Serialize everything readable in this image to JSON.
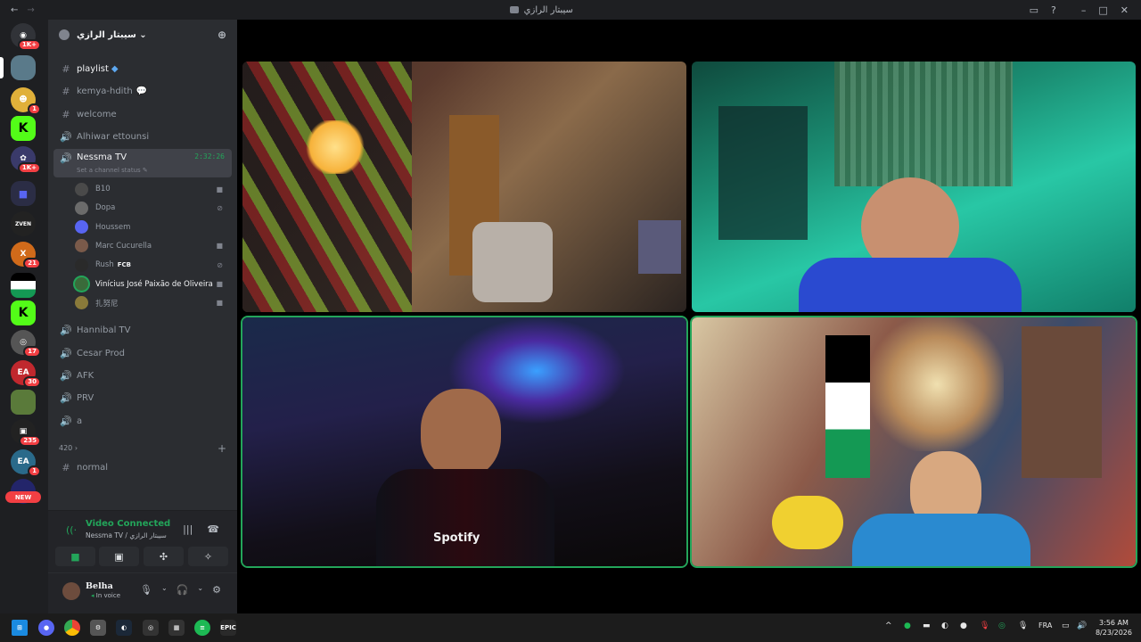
{
  "window": {
    "title": "سيبتار الرازي",
    "help_icon": "?"
  },
  "server": {
    "name": "سيبتار الرازي"
  },
  "rail": {
    "badges": [
      "1K+",
      "1",
      "1K+",
      "21",
      "17",
      "30",
      "235",
      "1"
    ],
    "new_label": "NEW"
  },
  "channels": [
    {
      "name": "playlist",
      "type": "text",
      "state": "bright"
    },
    {
      "name": "kemya-hdith",
      "type": "text"
    },
    {
      "name": "welcome",
      "type": "text"
    },
    {
      "name": "Alhiwar ettounsi",
      "type": "voice"
    },
    {
      "name": "Nessma TV",
      "type": "voice",
      "state": "active",
      "time": "2:32:26",
      "status_prompt": "Set a channel status"
    },
    {
      "name": "Hannibal TV",
      "type": "voice"
    },
    {
      "name": "Cesar Prod",
      "type": "voice"
    },
    {
      "name": "AFK",
      "type": "voice"
    },
    {
      "name": "PRV",
      "type": "voice"
    },
    {
      "name": "a",
      "type": "voice"
    }
  ],
  "members": [
    {
      "name": "B10",
      "color": "#4a4a4a",
      "video": true
    },
    {
      "name": "Dopa",
      "color": "#6b6b6b",
      "muted": true
    },
    {
      "name": "Houssem",
      "color": "#5865f2"
    },
    {
      "name": "Marc Cucurella",
      "color": "#7a5a4a",
      "video": true
    },
    {
      "name": "Rush",
      "color": "#2a2a2a",
      "tag": "FCB",
      "muted": true
    },
    {
      "name": "Vinícius José Paixão de Oliveira",
      "color": "#3a6b3a",
      "video": true,
      "speaking": true,
      "bright": true
    },
    {
      "name": "扎努尼",
      "color": "#8a7a3a",
      "video": true
    }
  ],
  "category": {
    "name": "420",
    "channel": "normal"
  },
  "voice_panel": {
    "title": "Video Connected",
    "subtitle": "Nessma TV / سيبتار الرازي"
  },
  "user": {
    "name": "Belha",
    "status": "In voice"
  },
  "tray": {
    "language": "FRA",
    "time": "3:56 AM",
    "date": "8/23/2026"
  },
  "colors": {
    "speaking": "#23a55a",
    "sidebar": "#2b2d31",
    "rail": "#1e1f22",
    "badge": "#f23f43"
  }
}
